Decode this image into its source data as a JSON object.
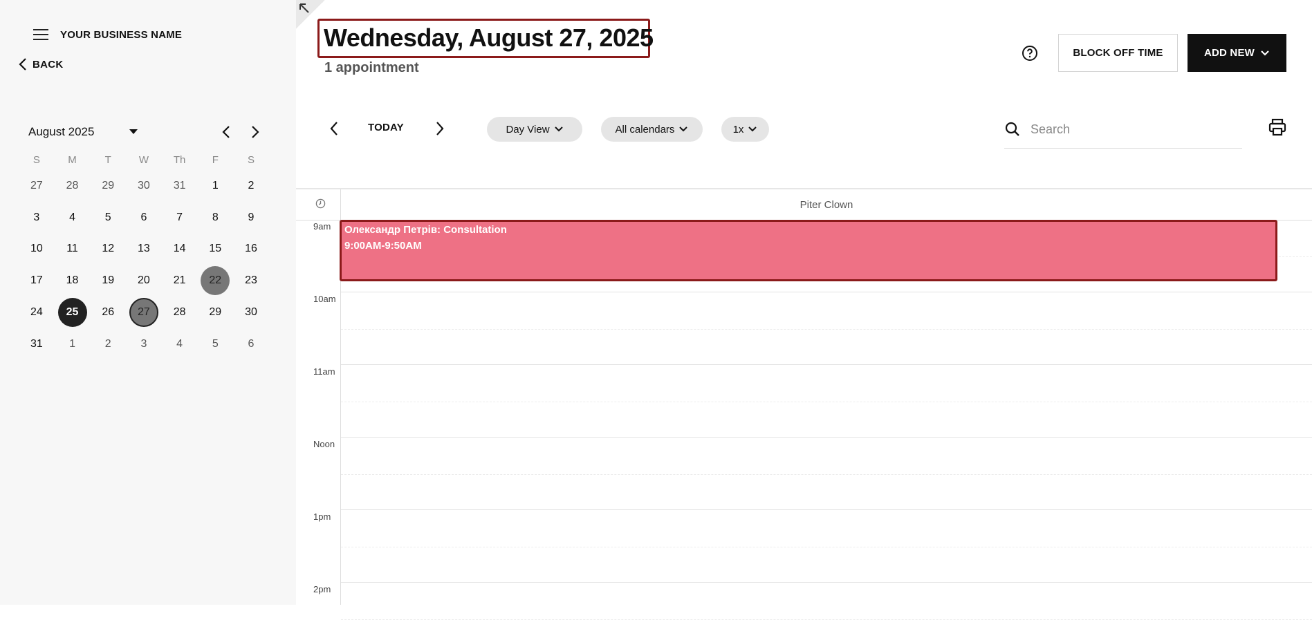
{
  "sidebar": {
    "business_name": "YOUR BUSINESS NAME",
    "back_label": "BACK",
    "month_label": "August 2025",
    "weekdays": [
      "S",
      "M",
      "T",
      "W",
      "Th",
      "F",
      "S"
    ],
    "weeks": [
      [
        "27",
        "28",
        "29",
        "30",
        "31",
        "1",
        "2"
      ],
      [
        "3",
        "4",
        "5",
        "6",
        "7",
        "8",
        "9"
      ],
      [
        "10",
        "11",
        "12",
        "13",
        "14",
        "15",
        "16"
      ],
      [
        "17",
        "18",
        "19",
        "20",
        "21",
        "22",
        "23"
      ],
      [
        "24",
        "25",
        "26",
        "27",
        "28",
        "29",
        "30"
      ],
      [
        "31",
        "1",
        "2",
        "3",
        "4",
        "5",
        "6"
      ]
    ],
    "today_day": "25",
    "selected_day": "27",
    "marked_day": "22"
  },
  "header": {
    "date_title": "Wednesday, August 27, 2025",
    "appointment_count": "1 appointment",
    "block_off_label": "BLOCK OFF TIME",
    "add_new_label": "ADD NEW"
  },
  "toolbar": {
    "today_label": "TODAY",
    "view_label": "Day View",
    "calendars_label": "All calendars",
    "zoom_label": "1x",
    "search_placeholder": "Search"
  },
  "schedule": {
    "column_name": "Piter Clown",
    "hours": [
      "9am",
      "10am",
      "11am",
      "Noon",
      "1pm",
      "2pm"
    ],
    "appointments": [
      {
        "title": "Олександр Петрів:  Consultation",
        "time": "9:00AM-9:50AM",
        "color": "#ee7185"
      }
    ]
  },
  "colors": {
    "accent_dark": "#111111",
    "highlight_border": "#8b1a1a",
    "appointment": "#ee7185"
  }
}
